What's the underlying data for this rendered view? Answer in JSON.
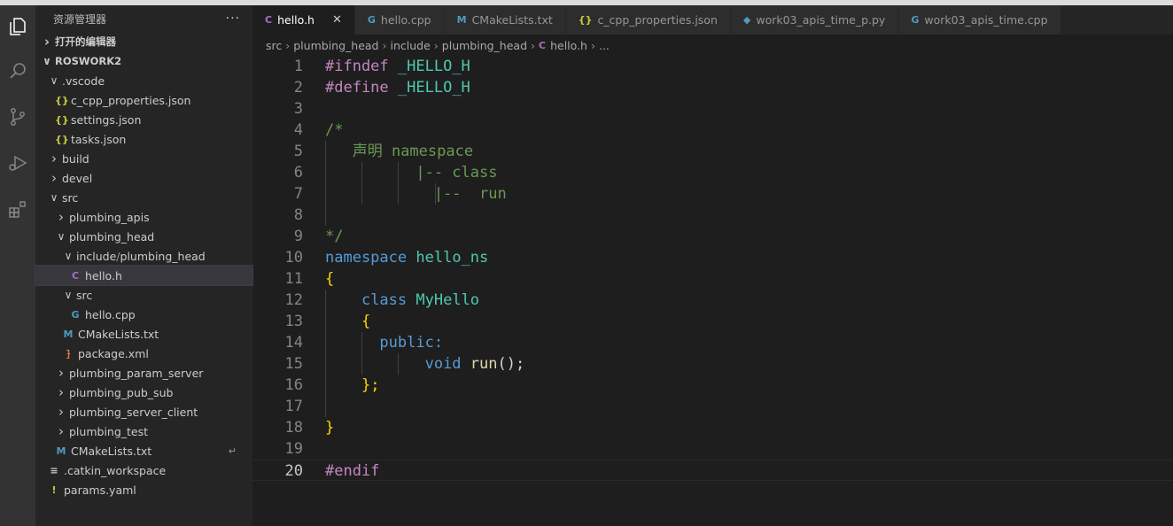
{
  "sidebar": {
    "title": "资源管理器",
    "more": "···",
    "open_editors": "打开的编辑器",
    "workspace": "ROSWORK2",
    "tree": [
      {
        "indent": 0,
        "chev": ">",
        "label": "打开的编辑器",
        "section": true
      },
      {
        "indent": 0,
        "chev": "v",
        "label": "ROSWORK2",
        "section": true
      },
      {
        "indent": 1,
        "chev": "v",
        "label": ".vscode"
      },
      {
        "indent": 2,
        "icon": "{}",
        "icon_class": "i-json",
        "label": "c_cpp_properties.json"
      },
      {
        "indent": 2,
        "icon": "{}",
        "icon_class": "i-json",
        "label": "settings.json"
      },
      {
        "indent": 2,
        "icon": "{}",
        "icon_class": "i-json",
        "label": "tasks.json"
      },
      {
        "indent": 1,
        "chev": ">",
        "label": "build"
      },
      {
        "indent": 1,
        "chev": ">",
        "label": "devel"
      },
      {
        "indent": 1,
        "chev": "v",
        "label": "src"
      },
      {
        "indent": 2,
        "chev": ">",
        "label": "plumbing_apis"
      },
      {
        "indent": 2,
        "chev": "v",
        "label": "plumbing_head"
      },
      {
        "indent": 3,
        "chev": "v",
        "label": "include",
        "label_dim": " / ",
        "label2": "plumbing_head"
      },
      {
        "indent": 4,
        "icon": "C",
        "icon_class": "i-c",
        "label": "hello.h",
        "selected": true
      },
      {
        "indent": 3,
        "chev": "v",
        "label": "src"
      },
      {
        "indent": 4,
        "icon": "G",
        "icon_class": "i-cpp",
        "label": "hello.cpp"
      },
      {
        "indent": 3,
        "icon": "M",
        "icon_class": "i-m",
        "label": "CMakeLists.txt"
      },
      {
        "indent": 3,
        "icon": "⹖",
        "icon_class": "i-rss",
        "label": "package.xml"
      },
      {
        "indent": 2,
        "chev": ">",
        "label": "plumbing_param_server"
      },
      {
        "indent": 2,
        "chev": ">",
        "label": "plumbing_pub_sub"
      },
      {
        "indent": 2,
        "chev": ">",
        "label": "plumbing_server_client"
      },
      {
        "indent": 2,
        "chev": ">",
        "label": "plumbing_test"
      },
      {
        "indent": 2,
        "icon": "M",
        "icon_class": "i-m",
        "label": "CMakeLists.txt",
        "trail": "↵"
      },
      {
        "indent": 1,
        "icon": "≡",
        "icon_class": "i-lines",
        "label": ".catkin_workspace"
      },
      {
        "indent": 1,
        "icon": "!",
        "icon_class": "i-bang",
        "label": "params.yaml"
      }
    ]
  },
  "tabs": [
    {
      "icon": "C",
      "icon_class": "i-c",
      "label": "hello.h",
      "active": true,
      "close": "✕"
    },
    {
      "icon": "G",
      "icon_class": "i-cpp",
      "label": "hello.cpp"
    },
    {
      "icon": "M",
      "icon_class": "i-m",
      "label": "CMakeLists.txt"
    },
    {
      "icon": "{}",
      "icon_class": "i-json",
      "label": "c_cpp_properties.json"
    },
    {
      "icon": "◆",
      "icon_class": "i-cpp",
      "label": "work03_apis_time_p.py"
    },
    {
      "icon": "G",
      "icon_class": "i-cpp",
      "label": "work03_apis_time.cpp"
    }
  ],
  "breadcrumb": [
    "src",
    "plumbing_head",
    "include",
    "plumbing_head",
    "hello.h",
    "..."
  ],
  "editor": {
    "current_line": 20,
    "lines": [
      {
        "n": "1",
        "tokens": [
          [
            "kw-pre",
            "#ifndef"
          ],
          [
            "punc",
            " "
          ],
          [
            "macro",
            "_HELLO_H"
          ]
        ]
      },
      {
        "n": "2",
        "tokens": [
          [
            "kw-pre",
            "#define"
          ],
          [
            "punc",
            " "
          ],
          [
            "macro",
            "_HELLO_H"
          ]
        ]
      },
      {
        "n": "3",
        "tokens": []
      },
      {
        "n": "4",
        "tokens": [
          [
            "cmt",
            "/*"
          ]
        ]
      },
      {
        "n": "5",
        "tokens": [
          [
            "cmt",
            "   声明 namespace"
          ]
        ],
        "guides": [
          1
        ]
      },
      {
        "n": "6",
        "tokens": [
          [
            "cmt",
            "          |-- class"
          ]
        ],
        "guides": [
          1,
          2,
          3
        ]
      },
      {
        "n": "7",
        "tokens": [
          [
            "cmt",
            "            |--  run"
          ]
        ],
        "guides": [
          1,
          2,
          3,
          4
        ]
      },
      {
        "n": "8",
        "tokens": [],
        "guides": [
          1
        ]
      },
      {
        "n": "9",
        "tokens": [
          [
            "cmt",
            "*/"
          ]
        ]
      },
      {
        "n": "10",
        "tokens": [
          [
            "kw",
            "namespace"
          ],
          [
            "punc",
            " "
          ],
          [
            "type",
            "hello_ns"
          ]
        ]
      },
      {
        "n": "11",
        "tokens": [
          [
            "brace",
            "{"
          ]
        ]
      },
      {
        "n": "12",
        "tokens": [
          [
            "punc",
            "    "
          ],
          [
            "kw",
            "class"
          ],
          [
            "punc",
            " "
          ],
          [
            "type",
            "MyHello"
          ]
        ],
        "guides": [
          1
        ]
      },
      {
        "n": "13",
        "tokens": [
          [
            "punc",
            "    "
          ],
          [
            "brace",
            "{"
          ]
        ],
        "guides": [
          1
        ]
      },
      {
        "n": "14",
        "tokens": [
          [
            "punc",
            "      "
          ],
          [
            "kw",
            "public:"
          ]
        ],
        "guides": [
          1,
          2
        ]
      },
      {
        "n": "15",
        "tokens": [
          [
            "punc",
            "           "
          ],
          [
            "kw",
            "void"
          ],
          [
            "punc",
            " "
          ],
          [
            "func",
            "run"
          ],
          [
            "punc",
            "();"
          ]
        ],
        "guides": [
          1,
          2,
          3
        ]
      },
      {
        "n": "16",
        "tokens": [
          [
            "punc",
            "    "
          ],
          [
            "brace",
            "};"
          ]
        ],
        "guides": [
          1
        ]
      },
      {
        "n": "17",
        "tokens": [],
        "guides": [
          1
        ]
      },
      {
        "n": "18",
        "tokens": [
          [
            "brace",
            "}"
          ]
        ]
      },
      {
        "n": "19",
        "tokens": []
      },
      {
        "n": "20",
        "tokens": [
          [
            "kw-pre",
            "#endif"
          ]
        ]
      }
    ]
  }
}
